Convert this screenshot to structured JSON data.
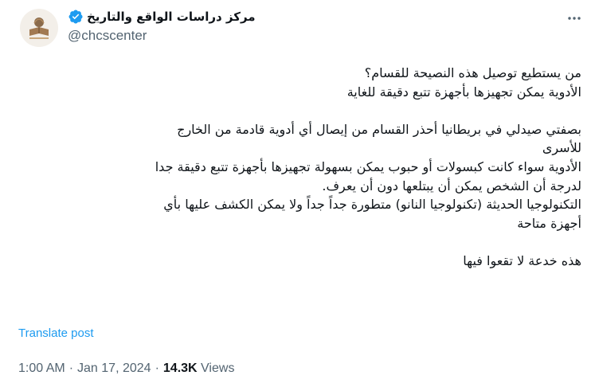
{
  "author": {
    "display_name": "مركز دراسات الواقع والتاريخ",
    "handle": "@chcscenter"
  },
  "post": {
    "lines": [
      "من يستطيع توصيل هذه النصيحة للقسام؟",
      "الأدوية يمكن تجهيزها بأجهزة تتبع دقيقة للغاية",
      "",
      "بصفتي صيدلي في بريطانيا أحذر القسام من إيصال أي أدوية قادمة من الخارج",
      "للأسرى",
      "الأدوية سواء كانت كبسولات أو حبوب يمكن بسهولة تجهيزها بأجهزة تتبع دقيقة جدا",
      "لدرجة أن الشخص يمكن أن يبتلعها دون أن يعرف.",
      "التكنولوجيا الحديثة (تكنولوجيا النانو) متطورة جداً جداً ولا يمكن الكشف عليها بأي",
      "أجهزة متاحة",
      "",
      "هذه خدعة لا تقعوا فيها"
    ]
  },
  "translate_label": "Translate post",
  "meta": {
    "time": "1:00 AM",
    "date": "Jan 17, 2024",
    "separator": "·",
    "views_count": "14.3K",
    "views_label": "Views"
  },
  "icons": {
    "verified": "verified-badge-icon",
    "more": "more-options-icon",
    "avatar": "organization-logo"
  },
  "colors": {
    "link": "#1d9bf0",
    "verified": "#1d9bf0",
    "secondary_text": "#536471",
    "primary_text": "#0f1419"
  }
}
